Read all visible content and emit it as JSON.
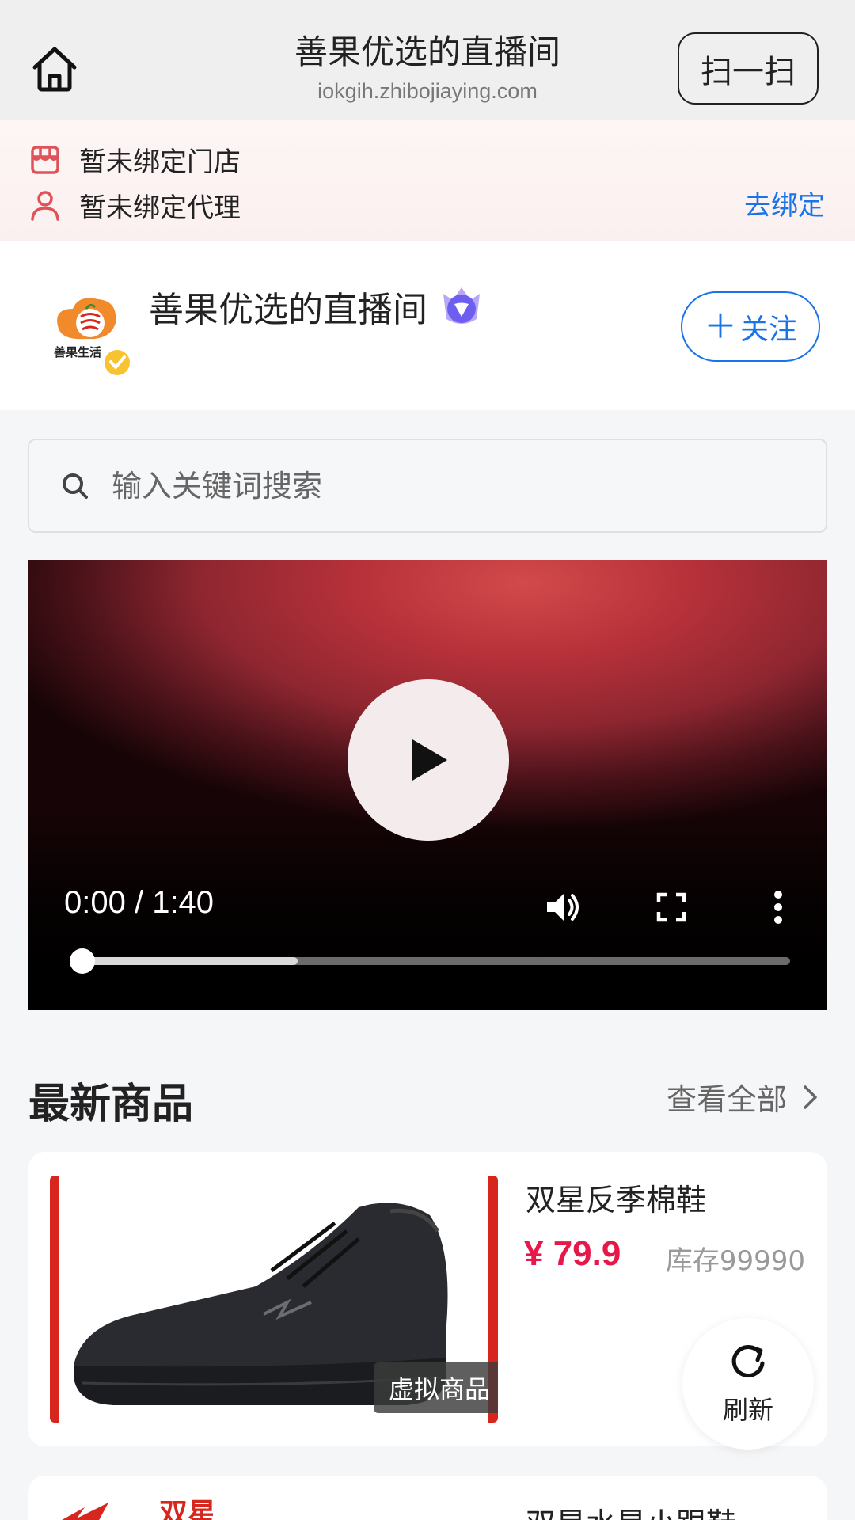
{
  "header": {
    "title": "善果优选的直播间",
    "url": "iokgih.zhibojiaying.com",
    "scan_label": "扫一扫"
  },
  "binding": {
    "store_text": "暂未绑定门店",
    "agent_text": "暂未绑定代理",
    "bind_link": "去绑定"
  },
  "profile": {
    "name": "善果优选的直播间",
    "logo_text": "善果生活",
    "follow_plus": "＋",
    "follow_label": "关注"
  },
  "search": {
    "placeholder": "输入关键词搜索"
  },
  "video": {
    "time": "0:00 / 1:40",
    "progress": 0,
    "buffered": 0.31
  },
  "products": {
    "section_title": "最新商品",
    "see_all": "查看全部",
    "items": [
      {
        "name": "双星反季棉鞋",
        "price": "¥ 79.9",
        "stock": "库存99990",
        "tag": "虚拟商品"
      },
      {
        "name": "双星水星小跟鞋",
        "brand": "双星"
      }
    ]
  },
  "refresh_label": "刷新",
  "colors": {
    "accent_blue": "#1a73e8",
    "price_red": "#e8174a",
    "brand_red": "#d7261e"
  }
}
